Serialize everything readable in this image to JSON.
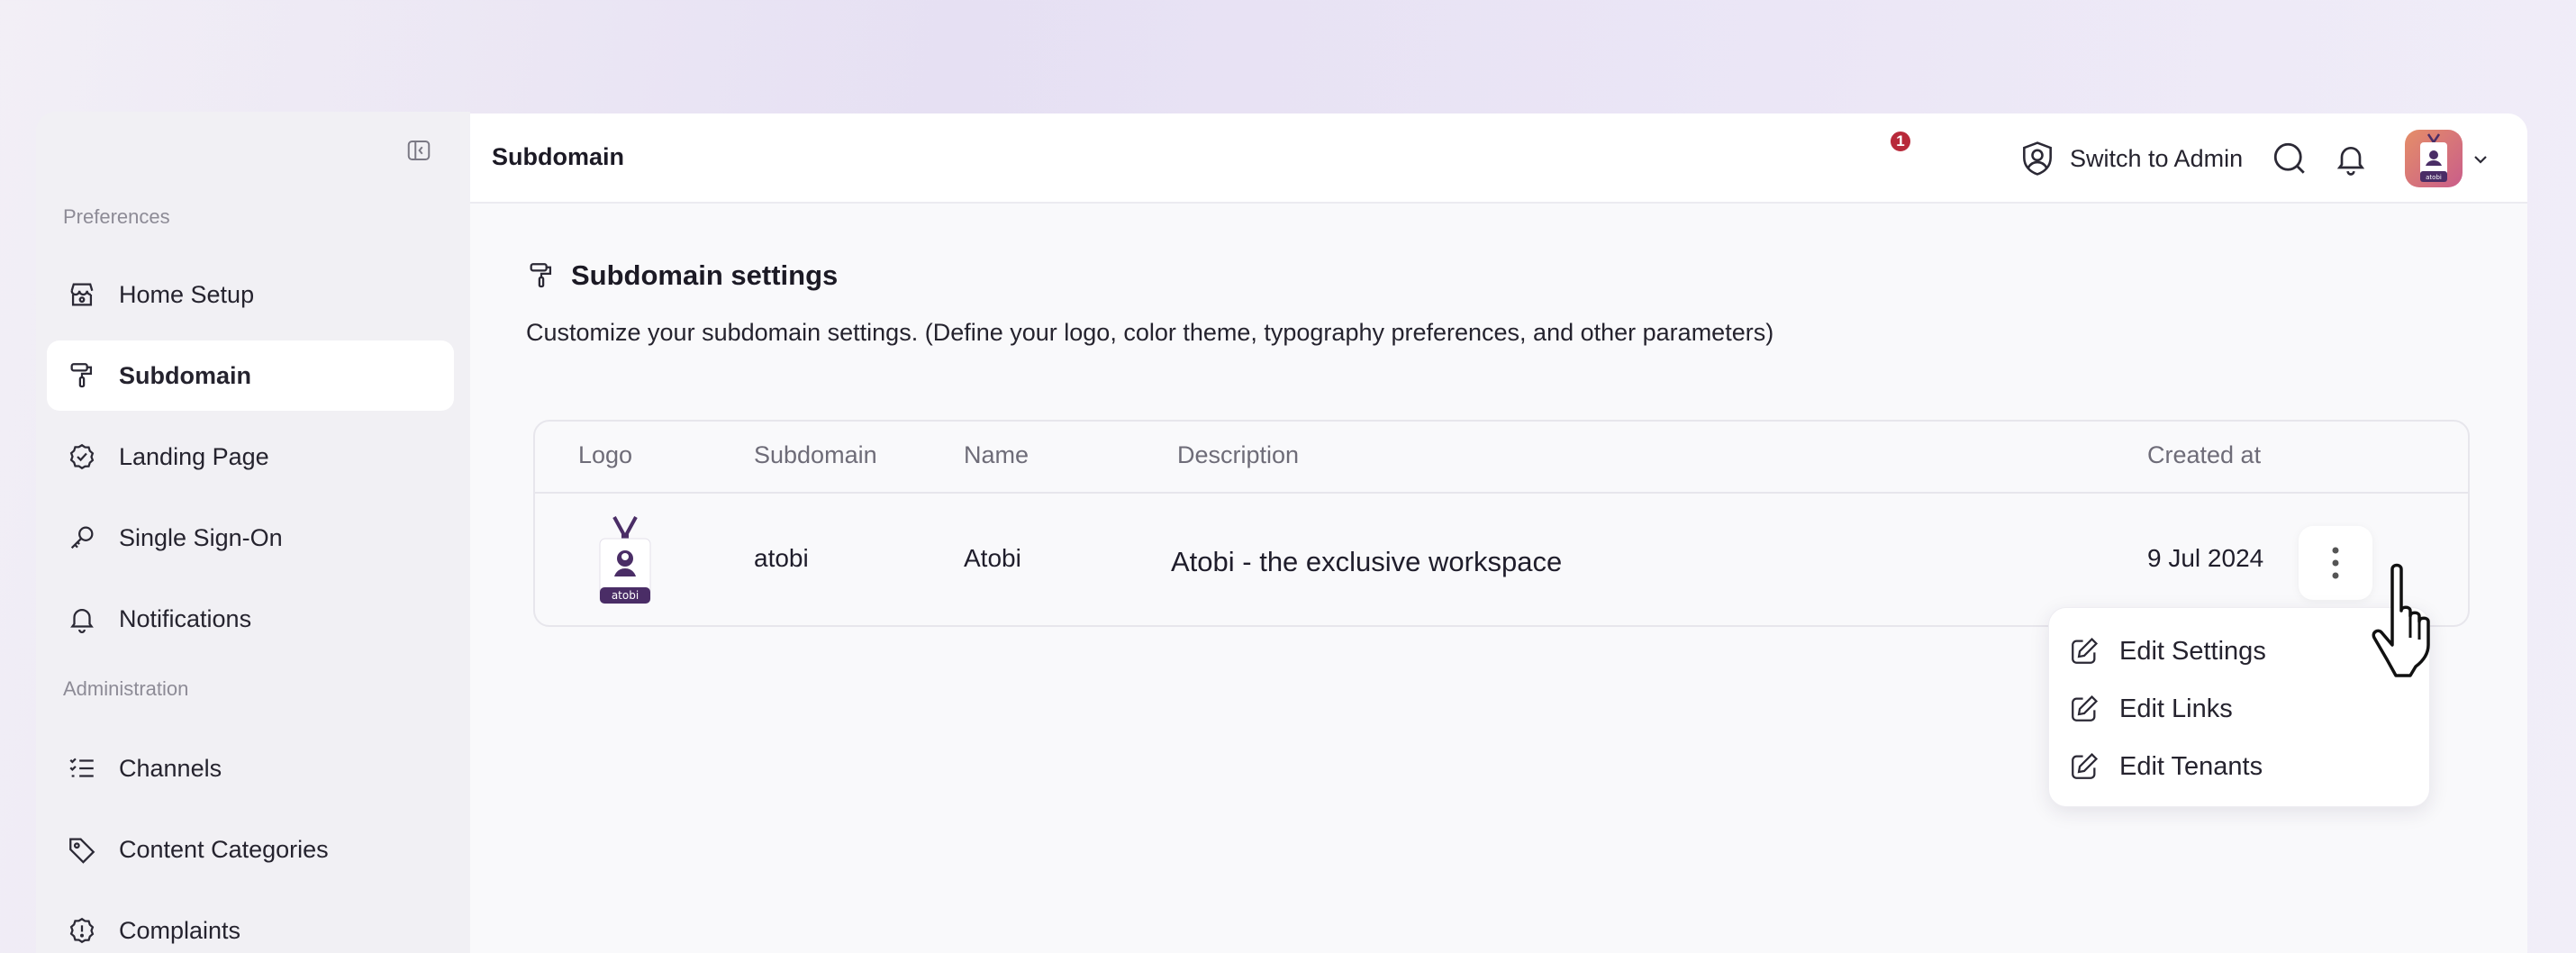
{
  "sidebar": {
    "section_preferences": "Preferences",
    "section_administration": "Administration",
    "items": [
      {
        "label": "Home Setup",
        "icon": "storefront-icon",
        "active": false
      },
      {
        "label": "Subdomain",
        "icon": "paint-roller-icon",
        "active": true
      },
      {
        "label": "Landing Page",
        "icon": "badge-check-icon",
        "active": false
      },
      {
        "label": "Single Sign-On",
        "icon": "key-icon",
        "active": false
      },
      {
        "label": "Notifications",
        "icon": "bell-icon",
        "active": false
      },
      {
        "label": "Channels",
        "icon": "checklist-icon",
        "active": false
      },
      {
        "label": "Content Categories",
        "icon": "tag-icon",
        "active": false
      },
      {
        "label": "Complaints",
        "icon": "alert-badge-icon",
        "active": false
      }
    ]
  },
  "header": {
    "title": "Subdomain",
    "switch_admin_label": "Switch to Admin",
    "notification_count": "1",
    "avatar_text": "atobi"
  },
  "settings": {
    "title": "Subdomain settings",
    "description": "Customize your subdomain settings. (Define your logo, color theme, typography preferences, and other parameters)"
  },
  "table": {
    "columns": [
      "Logo",
      "Subdomain",
      "Name",
      "Description",
      "Created at"
    ],
    "rows": [
      {
        "logo_text": "atobi",
        "subdomain": "atobi",
        "name": "Atobi",
        "description": "Atobi - the exclusive workspace",
        "created_at": "9 Jul 2024"
      }
    ]
  },
  "row_menu": {
    "items": [
      "Edit Settings",
      "Edit Links",
      "Edit Tenants"
    ]
  },
  "colors": {
    "accent": "#5c3d7a",
    "badge": "#b8293a",
    "active_bg": "#ffffff"
  }
}
